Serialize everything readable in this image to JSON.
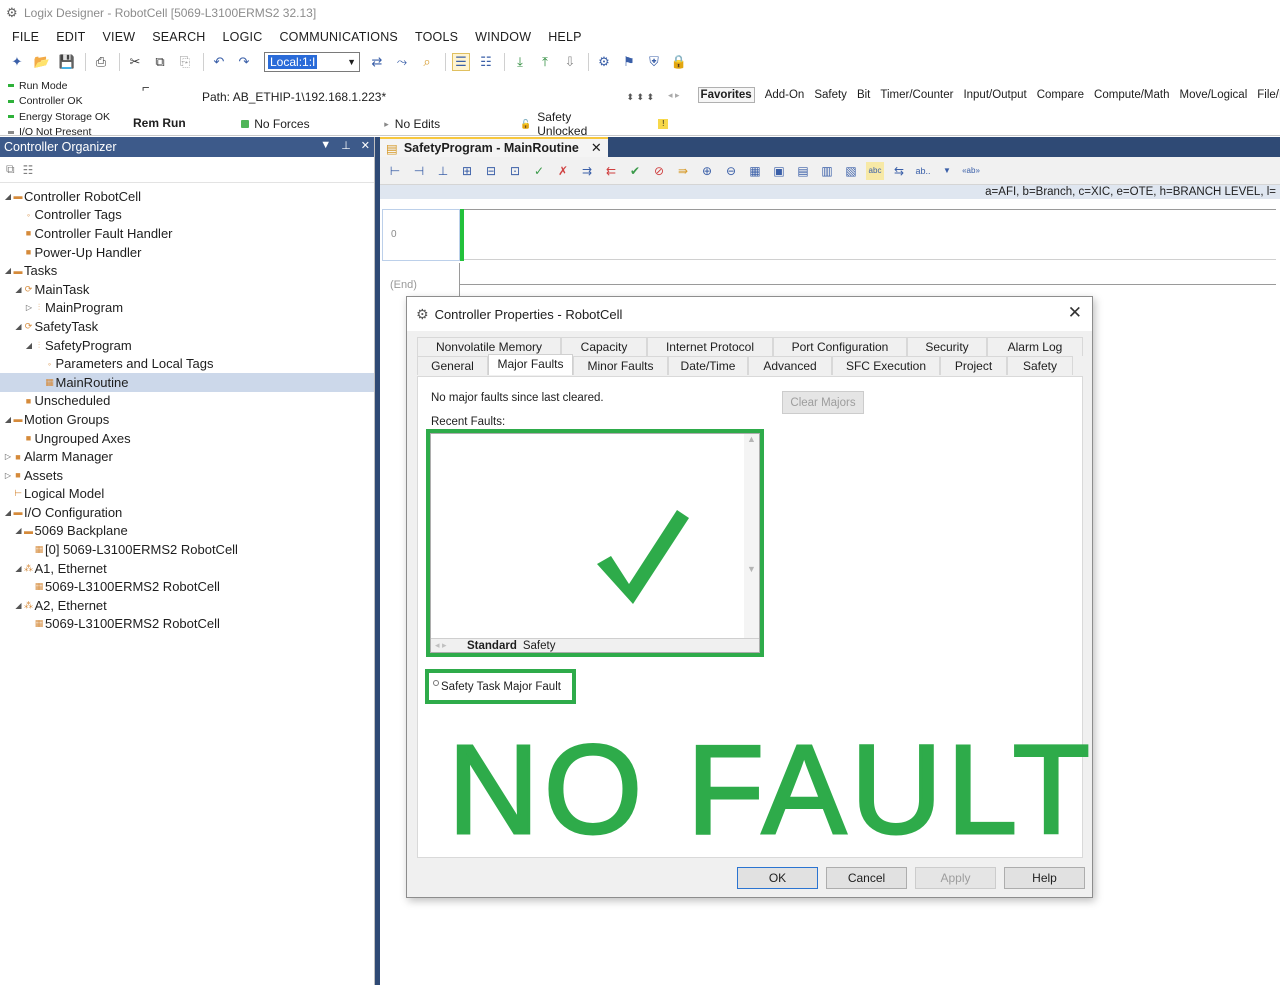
{
  "window": {
    "title": "Logix Designer - RobotCell [5069-L3100ERMS2 32.13]"
  },
  "menu": [
    "FILE",
    "EDIT",
    "VIEW",
    "SEARCH",
    "LOGIC",
    "COMMUNICATIONS",
    "TOOLS",
    "WINDOW",
    "HELP"
  ],
  "toolbar": {
    "comm_path": "Local:1:I"
  },
  "status": {
    "modes": [
      {
        "label": "Run Mode",
        "color": "#2eb13a"
      },
      {
        "label": "Controller OK",
        "color": "#2eb13a"
      },
      {
        "label": "Energy Storage OK",
        "color": "#2eb13a"
      },
      {
        "label": "I/O Not Present",
        "color": "#8a8a8a"
      }
    ],
    "run_state": "Rem Run",
    "path": "Path:  AB_ETHIP-1\\192.168.1.223*",
    "forces": "No Forces",
    "edits": "No Edits",
    "safety": "Safety Unlocked"
  },
  "instruction_tabs": [
    "Favorites",
    "Add-On",
    "Safety",
    "Bit",
    "Timer/Counter",
    "Input/Output",
    "Compare",
    "Compute/Math",
    "Move/Logical",
    "File/Misc"
  ],
  "organizer": {
    "title": "Controller Organizer",
    "tree": [
      {
        "label": "Controller RobotCell",
        "indent": 0,
        "exp": "◢",
        "icon": "▬"
      },
      {
        "label": "Controller Tags",
        "indent": 1,
        "exp": "",
        "icon": "◦"
      },
      {
        "label": "Controller Fault Handler",
        "indent": 1,
        "exp": "",
        "icon": "■"
      },
      {
        "label": "Power-Up Handler",
        "indent": 1,
        "exp": "",
        "icon": "■"
      },
      {
        "label": "Tasks",
        "indent": 0,
        "exp": "◢",
        "icon": "▬"
      },
      {
        "label": "MainTask",
        "indent": 1,
        "exp": "◢",
        "icon": "⟳"
      },
      {
        "label": "MainProgram",
        "indent": 2,
        "exp": "▷",
        "icon": "⫶"
      },
      {
        "label": "SafetyTask",
        "indent": 1,
        "exp": "◢",
        "icon": "⟳"
      },
      {
        "label": "SafetyProgram",
        "indent": 2,
        "exp": "◢",
        "icon": "⫶"
      },
      {
        "label": "Parameters and Local Tags",
        "indent": 3,
        "exp": "",
        "icon": "◦"
      },
      {
        "label": "MainRoutine",
        "indent": 3,
        "exp": "",
        "icon": "▦",
        "selected": true
      },
      {
        "label": "Unscheduled",
        "indent": 1,
        "exp": "",
        "icon": "■"
      },
      {
        "label": "Motion Groups",
        "indent": 0,
        "exp": "◢",
        "icon": "▬"
      },
      {
        "label": "Ungrouped Axes",
        "indent": 1,
        "exp": "",
        "icon": "■"
      },
      {
        "label": "Alarm Manager",
        "indent": 0,
        "exp": "▷",
        "icon": "■"
      },
      {
        "label": "Assets",
        "indent": 0,
        "exp": "▷",
        "icon": "■"
      },
      {
        "label": "Logical Model",
        "indent": 0,
        "exp": "",
        "icon": "⊢"
      },
      {
        "label": "I/O Configuration",
        "indent": 0,
        "exp": "◢",
        "icon": "▬"
      },
      {
        "label": "5069 Backplane",
        "indent": 1,
        "exp": "◢",
        "icon": "▬"
      },
      {
        "label": "[0] 5069-L3100ERMS2 RobotCell",
        "indent": 2,
        "exp": "",
        "icon": "▦"
      },
      {
        "label": "A1, Ethernet",
        "indent": 1,
        "exp": "◢",
        "icon": "⁂"
      },
      {
        "label": "5069-L3100ERMS2 RobotCell",
        "indent": 2,
        "exp": "",
        "icon": "▦"
      },
      {
        "label": "A2, Ethernet",
        "indent": 1,
        "exp": "◢",
        "icon": "⁂"
      },
      {
        "label": "5069-L3100ERMS2 RobotCell",
        "indent": 2,
        "exp": "",
        "icon": "▦"
      }
    ]
  },
  "editor": {
    "tab_title": "SafetyProgram - MainRoutine",
    "legend": "a=AFI, b=Branch, c=XIC, e=OTE, h=BRANCH LEVEL, l=",
    "rung_number": "0",
    "end_label": "(End)"
  },
  "dialog": {
    "title": "Controller Properties - RobotCell",
    "tabs_row1": [
      "Nonvolatile Memory",
      "Capacity",
      "Internet Protocol",
      "Port Configuration",
      "Security",
      "Alarm Log"
    ],
    "tabs_row2": [
      "General",
      "Major Faults",
      "Minor Faults",
      "Date/Time",
      "Advanced",
      "SFC Execution",
      "Project",
      "Safety"
    ],
    "active_tab": "Major Faults",
    "no_faults_text": "No major faults since last cleared.",
    "clear_majors": "Clear Majors",
    "recent_faults_label": "Recent Faults:",
    "bottom_tabs": [
      "Standard",
      "Safety"
    ],
    "safety_task_fault": "Safety Task Major Fault",
    "banner": "NO FAULT",
    "buttons": {
      "ok": "OK",
      "cancel": "Cancel",
      "apply": "Apply",
      "help": "Help"
    },
    "accent_color": "#2eab4a"
  }
}
